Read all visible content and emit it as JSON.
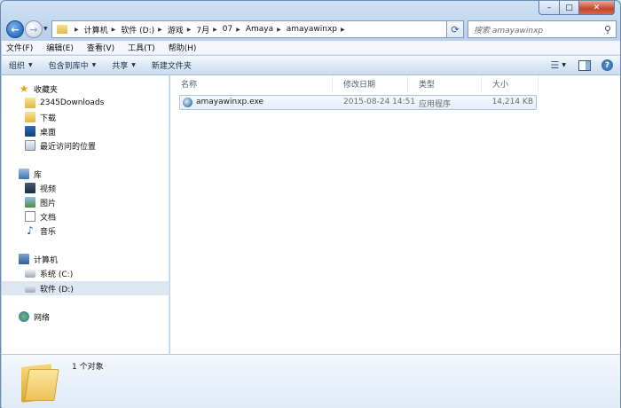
{
  "window": {
    "min_glyph": "–",
    "max_glyph": "□",
    "close_glyph": "✕"
  },
  "address_bar": {
    "crumbs": [
      "计算机",
      "软件 (D:)",
      "游戏",
      "7月",
      "07",
      "Amaya",
      "amayawinxp"
    ]
  },
  "search": {
    "placeholder": "搜索 amayawinxp"
  },
  "menu": {
    "items": [
      "文件(F)",
      "编辑(E)",
      "查看(V)",
      "工具(T)",
      "帮助(H)"
    ]
  },
  "toolbar": {
    "organize": "组织",
    "include_library": "包含到库中",
    "share": "共享",
    "new_folder": "新建文件夹"
  },
  "nav_pane": {
    "favorites": "收藏夹",
    "favorites_items": [
      "2345Downloads",
      "下载",
      "桌面",
      "最近访问的位置"
    ],
    "libraries": "库",
    "library_items": [
      "视频",
      "图片",
      "文档",
      "音乐"
    ],
    "computer": "计算机",
    "computer_items": [
      "系统 (C:)",
      "软件 (D:)"
    ],
    "network": "网络"
  },
  "columns": {
    "name": "名称",
    "modified": "修改日期",
    "type": "类型",
    "size": "大小"
  },
  "files": [
    {
      "name": "amayawinxp.exe",
      "modified": "2015-08-24 14:51",
      "type": "应用程序",
      "size": "14,214 KB"
    }
  ],
  "details": {
    "count_text": "1 个对象"
  }
}
